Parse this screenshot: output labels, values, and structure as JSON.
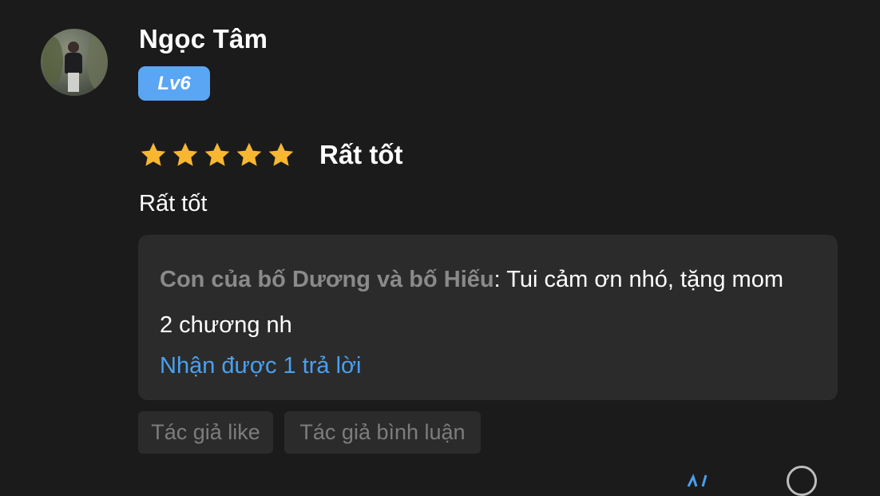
{
  "user": {
    "name": "Ngọc Tâm",
    "level": "Lv6"
  },
  "rating": {
    "stars": 5,
    "max_stars": 5,
    "label": "Rất tốt",
    "star_color": "#f7b731"
  },
  "review": {
    "text": "Rất tốt"
  },
  "reply": {
    "author": "Con của bố Dương và bố Hiếu",
    "separator": ": ",
    "message": "Tui cảm ơn nhó, tặng mom 2 chương nh",
    "replies_count_text": "Nhận được 1 trả lời"
  },
  "tags": [
    "Tác giả like",
    "Tác giả bình luận"
  ],
  "colors": {
    "background": "#1b1b1b",
    "card": "#2b2b2b",
    "accent_blue": "#4aa0f0",
    "badge_blue": "#5aa6f5"
  }
}
